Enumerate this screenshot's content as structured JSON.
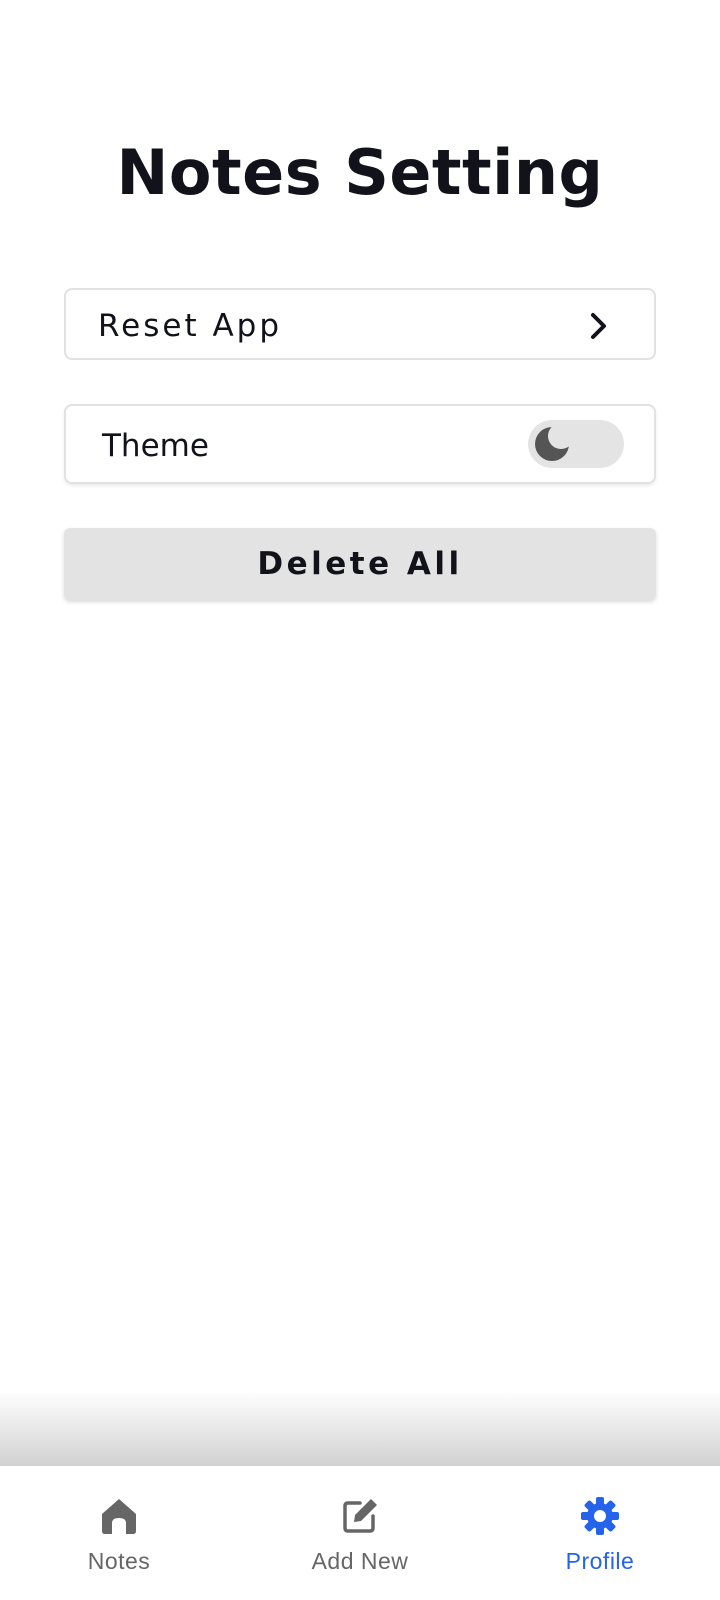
{
  "page": {
    "title": "Notes Setting"
  },
  "settings": {
    "reset_label": "Reset App",
    "theme_label": "Theme",
    "theme_dark_mode": false,
    "delete_label": "Delete All"
  },
  "bottom_nav": {
    "items": [
      {
        "label": "Notes",
        "icon": "home-icon",
        "active": false
      },
      {
        "label": "Add New",
        "icon": "edit-icon",
        "active": false
      },
      {
        "label": "Profile",
        "icon": "gear-icon",
        "active": true
      }
    ]
  },
  "colors": {
    "accent": "#2563eb",
    "inactive": "#666666",
    "text": "#12131a",
    "button_bg": "#e3e3e3"
  }
}
